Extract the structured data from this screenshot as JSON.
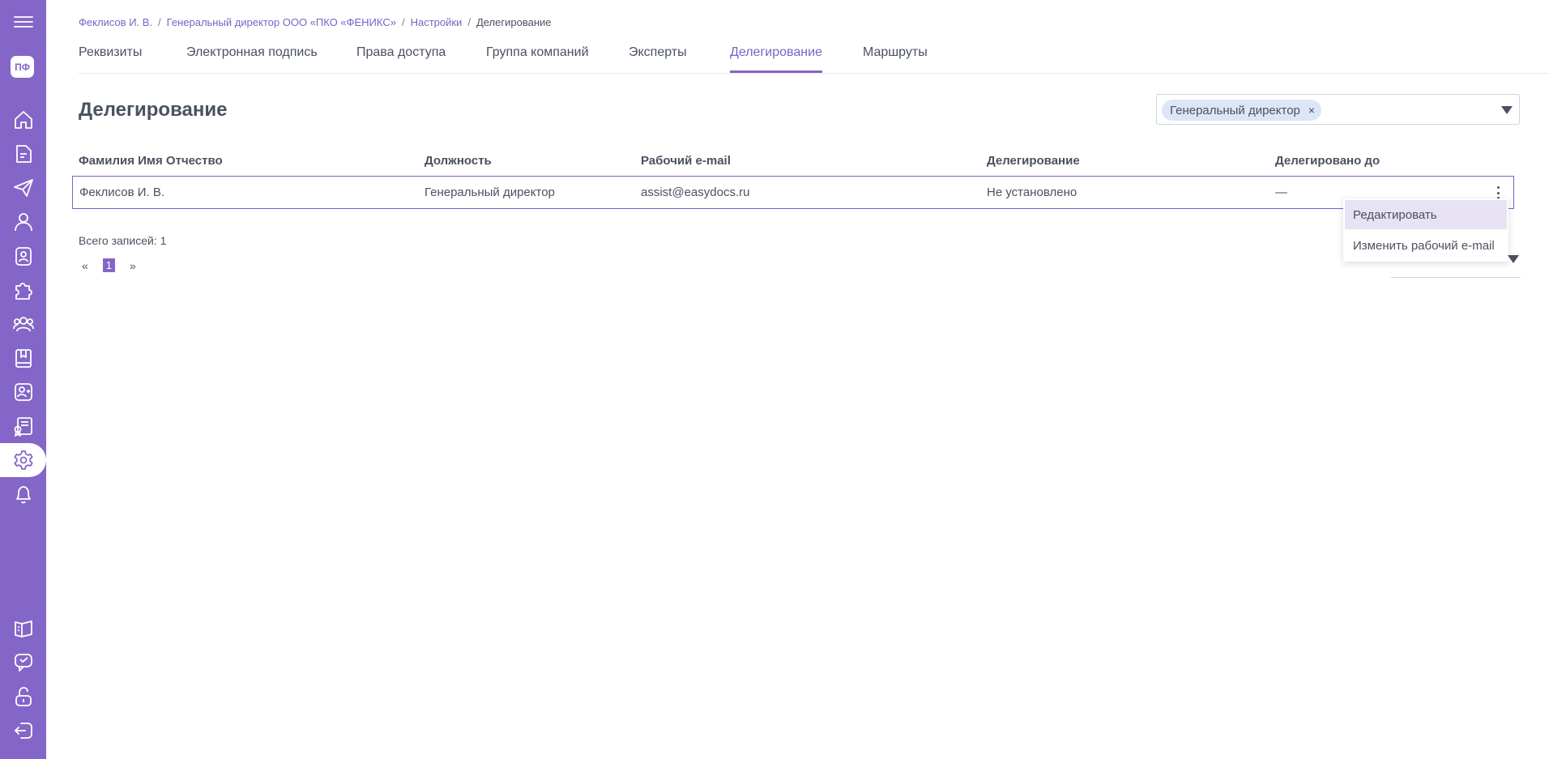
{
  "sidebar": {
    "avatar_initials": "ПФ",
    "colors": {
      "background": "#8466c8",
      "icon": "#ffffff",
      "active_background": "#ffffff"
    },
    "icons": [
      "menu-icon",
      "home-icon",
      "document-icon",
      "send-icon",
      "user-icon",
      "contact-card-icon",
      "puzzle-icon",
      "group-icon",
      "book-icon",
      "contact-add-icon",
      "certificate-icon",
      "gear-icon",
      "bell-icon",
      "open-book-icon",
      "support-icon",
      "unlock-icon",
      "logout-icon"
    ]
  },
  "breadcrumb": {
    "items": [
      "Феклисов И. В.",
      "Генеральный директор ООО «ПКО «ФЕНИКС»",
      "Настройки"
    ],
    "current": "Делегирование",
    "separator": "/"
  },
  "tabs": [
    {
      "label": "Реквизиты"
    },
    {
      "label": "Электронная подпись"
    },
    {
      "label": "Права доступа"
    },
    {
      "label": "Группа компаний"
    },
    {
      "label": "Эксперты"
    },
    {
      "label": "Делегирование",
      "active": true
    },
    {
      "label": "Маршруты"
    }
  ],
  "page": {
    "title": "Делегирование"
  },
  "filter": {
    "chip_label": "Генеральный директор",
    "chip_remove": "×"
  },
  "table": {
    "columns": [
      "Фамилия Имя Отчество",
      "Должность",
      "Рабочий e-mail",
      "Делегирование",
      "Делегировано до"
    ],
    "rows": [
      [
        "Феклисов И. В.",
        "Генеральный директор",
        "assist@easydocs.ru",
        "Не установлено",
        "—"
      ]
    ]
  },
  "context_menu": {
    "items": [
      "Редактировать",
      "Изменить рабочий e-mail"
    ]
  },
  "footer": {
    "total": "Всего записей: 1",
    "prev": "«",
    "current_page": "1",
    "next": "»"
  },
  "colors": {
    "accent": "#8466c8",
    "text": "#4a5160",
    "link": "#7a63c4"
  }
}
